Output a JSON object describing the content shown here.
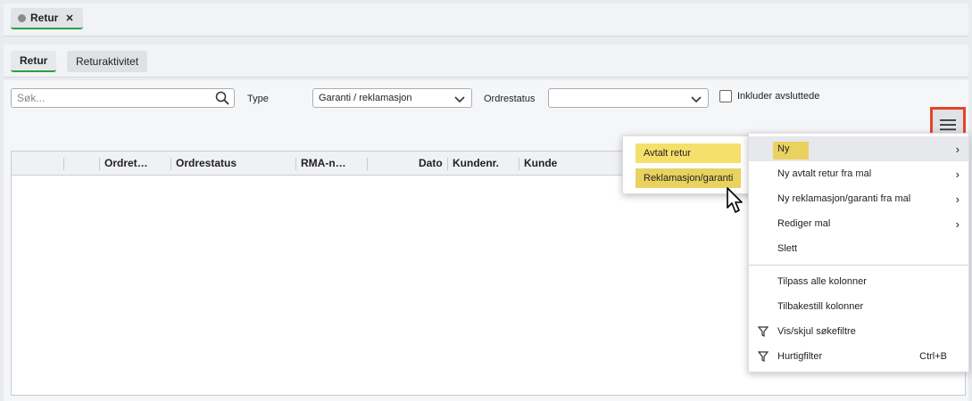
{
  "doc_tab": {
    "label": "Retur",
    "close": "✕"
  },
  "subtabs": [
    {
      "label": "Retur"
    },
    {
      "label": "Returaktivitet"
    }
  ],
  "filters": {
    "search_placeholder": "Søk...",
    "type_label": "Type",
    "type_value": "Garanti / reklamasjon",
    "ordrestatus_label": "Ordrestatus",
    "ordrestatus_value": "",
    "include_closed_label": "Inkluder avsluttede"
  },
  "grid": {
    "columns": [
      "Ordret…",
      "Ordrestatus",
      "RMA-n…",
      "Dato",
      "Kundenr.",
      "Kunde"
    ]
  },
  "submenu": {
    "items": [
      "Avtalt retur",
      "Reklamasjon/garanti"
    ]
  },
  "menu": {
    "items": [
      {
        "label": "Ny",
        "arrow": "›"
      },
      {
        "label": "Ny avtalt retur fra mal",
        "arrow": "›"
      },
      {
        "label": "Ny reklamasjon/garanti fra mal",
        "arrow": "›"
      },
      {
        "label": "Rediger mal",
        "arrow": "›"
      },
      {
        "label": "Slett"
      },
      {
        "label": "Tilpass alle kolonner"
      },
      {
        "label": "Tilbakestill kolonner"
      },
      {
        "label": "Vis/skjul søkefiltre"
      },
      {
        "label": "Hurtigfilter",
        "shortcut": "Ctrl+B"
      }
    ]
  },
  "colors": {
    "accent_green": "#2aa23c",
    "highlight_red": "#e5442a",
    "yellow": "#f4e06a"
  }
}
